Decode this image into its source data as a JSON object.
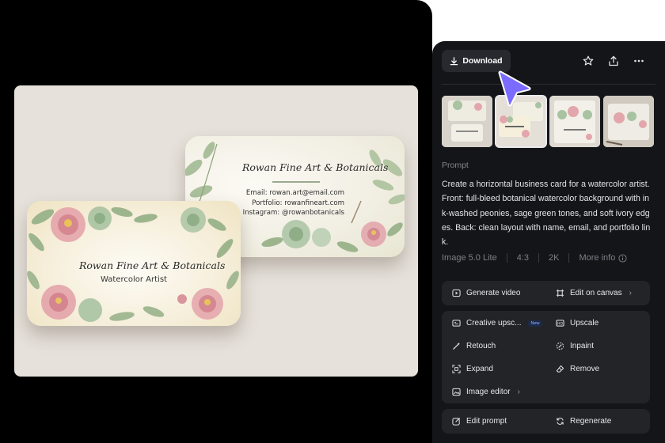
{
  "preview": {
    "back_card": {
      "title": "Rowan Fine Art & Botanicals",
      "email": "Email: rowan.art@email.com",
      "portfolio": "Portfolio: rowanfineart.com",
      "instagram": "Instagram: @rowanbotanicals"
    },
    "front_card": {
      "title": "Rowan Fine Art & Botanicals",
      "subtitle": "Watercolor Artist"
    }
  },
  "toolbar": {
    "download_label": "Download",
    "icons": [
      "download-icon",
      "star-icon",
      "share-icon",
      "more-icon"
    ]
  },
  "thumbnails": {
    "count": 4,
    "selected_index": 1
  },
  "prompt": {
    "label": "Prompt",
    "text": "Create a horizontal business card for a watercolor artist. Front: full-bleed botanical watercolor background with ink-washed peonies, sage green tones, and soft ivory edges. Back: clean layout with name, email, and portfolio link."
  },
  "meta": {
    "model": "Image 5.0 Lite",
    "ratio": "4:3",
    "resolution": "2K",
    "more_info": "More info"
  },
  "actions": {
    "generate_video": "Generate video",
    "edit_on_canvas": "Edit on canvas",
    "creative_upscale": "Creative upsc...",
    "new_badge": "New",
    "upscale": "Upscale",
    "retouch": "Retouch",
    "inpaint": "Inpaint",
    "expand": "Expand",
    "remove": "Remove",
    "image_editor": "Image editor",
    "edit_prompt": "Edit prompt",
    "regenerate": "Regenerate"
  },
  "colors": {
    "panel_bg": "#141518",
    "button_bg": "#222428",
    "cursor_accent": "#7b6cff",
    "stage_bg": "#000000"
  }
}
